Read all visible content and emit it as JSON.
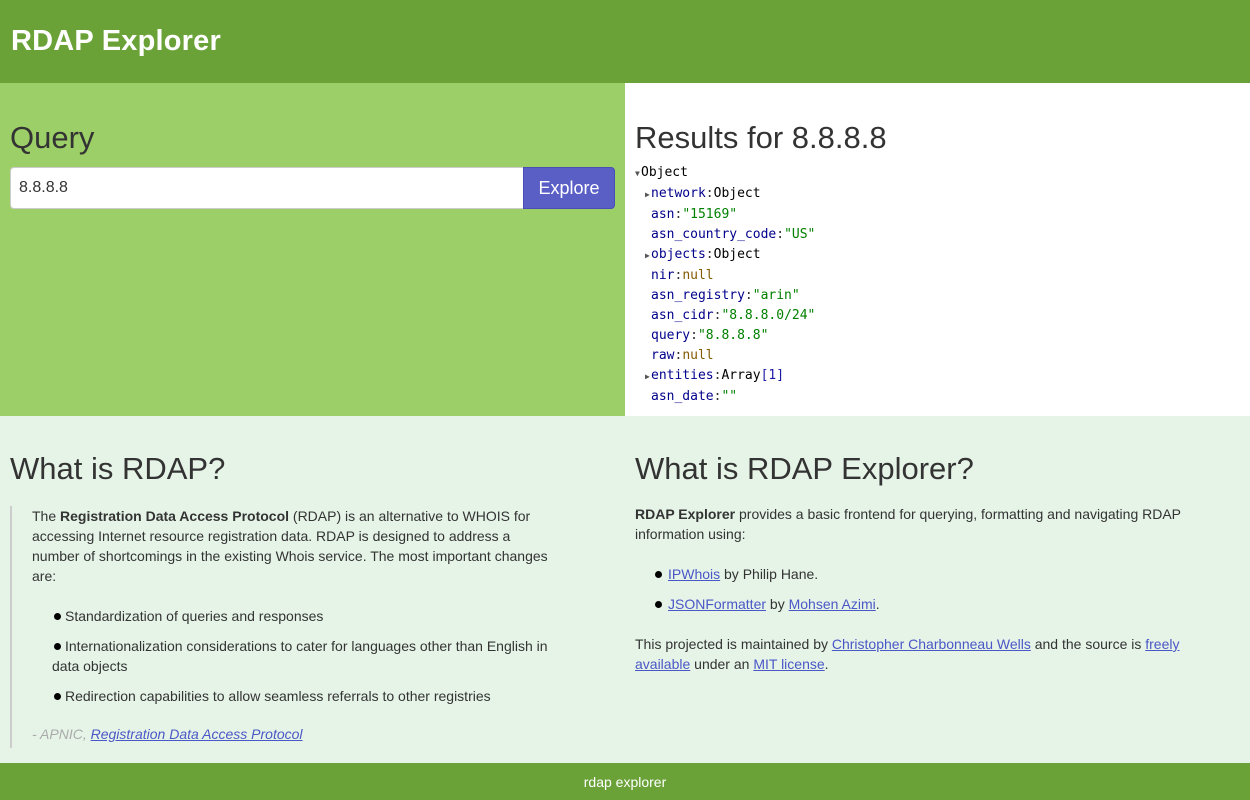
{
  "header": {
    "title": "RDAP Explorer"
  },
  "query": {
    "heading": "Query",
    "input_value": "8.8.8.8",
    "button_label": "Explore"
  },
  "results": {
    "heading_prefix": "Results for ",
    "heading_query": "8.8.8.8",
    "root_label": "Object",
    "rows": [
      {
        "key": "network",
        "value": "Object",
        "type": "obj",
        "collapsible": true
      },
      {
        "key": "asn",
        "value": "\"15169\"",
        "type": "str",
        "collapsible": false
      },
      {
        "key": "asn_country_code",
        "value": "\"US\"",
        "type": "str",
        "collapsible": false
      },
      {
        "key": "objects",
        "value": "Object",
        "type": "obj",
        "collapsible": true
      },
      {
        "key": "nir",
        "value": "null",
        "type": "null",
        "collapsible": false
      },
      {
        "key": "asn_registry",
        "value": "\"arin\"",
        "type": "str",
        "collapsible": false
      },
      {
        "key": "asn_cidr",
        "value": "\"8.8.8.0/24\"",
        "type": "str",
        "collapsible": false
      },
      {
        "key": "query",
        "value": "\"8.8.8.8\"",
        "type": "str",
        "collapsible": false
      },
      {
        "key": "raw",
        "value": "null",
        "type": "null",
        "collapsible": false
      },
      {
        "key": "entities",
        "value": "Array",
        "len": "[1]",
        "type": "arr",
        "collapsible": true
      },
      {
        "key": "asn_date",
        "value": "\"\"",
        "type": "str",
        "collapsible": false
      }
    ]
  },
  "what_is_rdap": {
    "heading": "What is RDAP?",
    "intro_pre": "The ",
    "intro_bold": "Registration Data Access Protocol",
    "intro_post": " (RDAP) is an alternative to WHOIS for accessing Internet resource registration data. RDAP is designed to address a number of shortcomings in the existing Whois service. The most important changes are:",
    "items": [
      "Standardization of queries and responses",
      "Internationalization considerations to cater for languages other than English in data objects",
      "Redirection capabilities to allow seamless referrals to other registries"
    ],
    "source_prefix": "- APNIC, ",
    "source_link": "Registration Data Access Protocol"
  },
  "what_is_explorer": {
    "heading": "What is RDAP Explorer?",
    "intro_bold": "RDAP Explorer",
    "intro_post": " provides a basic frontend for querying, formatting and navigating RDAP information using:",
    "items": [
      {
        "link": "IPWhois",
        "mid": " by Philip Hane.",
        "link2": "",
        "end": ""
      },
      {
        "link": "JSONFormatter",
        "mid": " by ",
        "link2": "Mohsen Azimi",
        "end": "."
      }
    ],
    "maint_pre": "This projected is maintained by ",
    "maint_link1": "Christopher Charbonneau Wells",
    "maint_mid": " and the source is ",
    "maint_link2": "freely available",
    "maint_mid2": " under an ",
    "maint_link3": "MIT license",
    "maint_end": "."
  },
  "footer": {
    "text": "rdap explorer"
  }
}
